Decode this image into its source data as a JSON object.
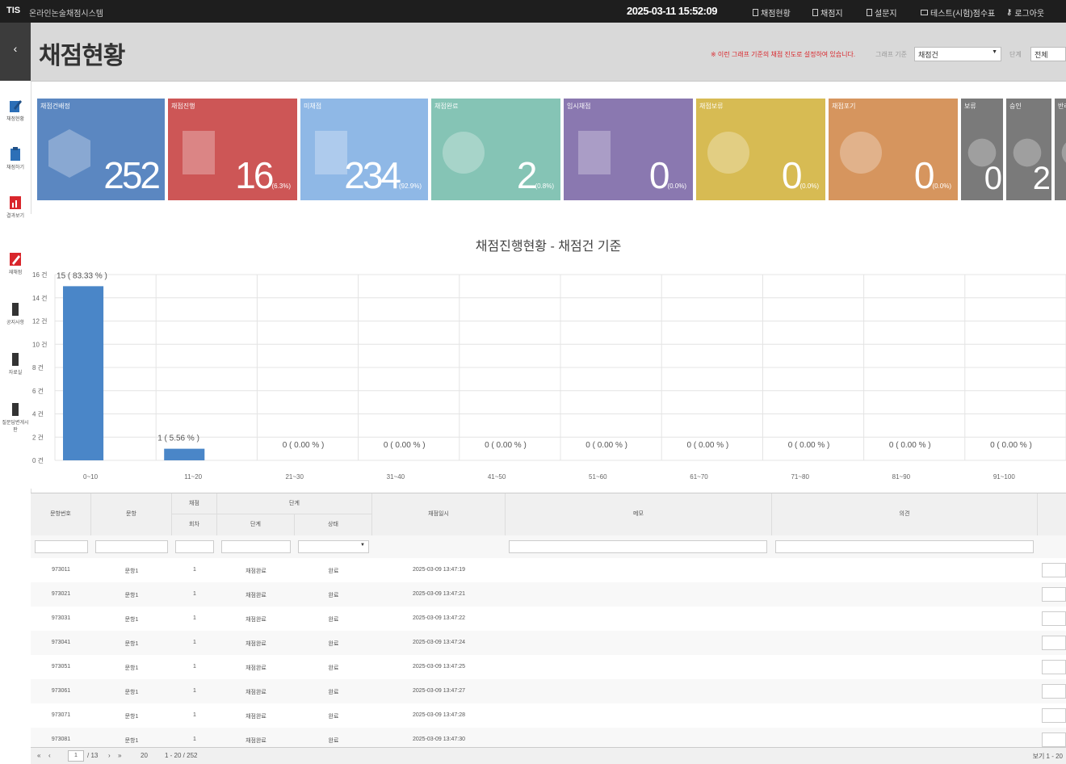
{
  "topbar": {
    "logo": "TIS",
    "app_name": "온라인논술채점시스템",
    "clock": "2025-03-11 15:52:09",
    "menu": [
      {
        "label": "채점현황",
        "icon": "doc-icon"
      },
      {
        "label": "채점지",
        "icon": "device-icon"
      },
      {
        "label": "설문지",
        "icon": "device-icon"
      },
      {
        "label": "테스트(시험)점수표",
        "icon": "mail-icon"
      },
      {
        "label": "로그아웃",
        "icon": "key-icon"
      }
    ]
  },
  "sidenav": {
    "items": [
      {
        "label": "채점현황",
        "icon": "edit-icon"
      },
      {
        "label": "채점하기",
        "icon": "doc-icon"
      },
      {
        "label": "결과보기",
        "icon": "chart-icon"
      },
      {
        "label": "재채점",
        "icon": "pen-icon"
      },
      {
        "label": "공지사항",
        "icon": "phone-icon"
      },
      {
        "label": "자료실",
        "icon": "phone-icon"
      },
      {
        "label": "질문답변게시판",
        "icon": "phone-icon"
      }
    ]
  },
  "header": {
    "title": "채점현황",
    "note": "※ 이런 그래프 기준의 채점 진도로 설정하여 있습니다.",
    "filter1_label": "그래프 기준",
    "filter1_value": "채점건",
    "filter2_label": "단계",
    "filter2_value": "전체"
  },
  "cards": [
    {
      "title": "채점건배정",
      "value": "252",
      "pct": "",
      "color": "#5b87c1",
      "icon": "box-icon"
    },
    {
      "title": "채점진행",
      "value": "16",
      "pct": "(6.3%)",
      "color": "#cd5656",
      "icon": "form-check-icon"
    },
    {
      "title": "미채점",
      "value": "234",
      "pct": "(92.9%)",
      "color": "#8fb8e6",
      "icon": "paper-icon"
    },
    {
      "title": "채점완료",
      "value": "2",
      "pct": "(0.8%)",
      "color": "#85c4b5",
      "icon": "check-circle-icon"
    },
    {
      "title": "임시채점",
      "value": "0",
      "pct": "(0.0%)",
      "color": "#8a78b0",
      "icon": "form-pen-icon"
    },
    {
      "title": "채점보류",
      "value": "0",
      "pct": "(0.0%)",
      "color": "#d7bb53",
      "icon": "alert-circle-icon"
    },
    {
      "title": "채점포기",
      "value": "0",
      "pct": "(0.0%)",
      "color": "#d6955e",
      "icon": "x-circle-icon"
    },
    {
      "title": "보류",
      "value": "0",
      "pct": "",
      "color": "#7a7a7a",
      "icon": "alert-circle-icon"
    },
    {
      "title": "승인",
      "value": "2",
      "pct": "",
      "color": "#7a7a7a",
      "icon": "check-circle-icon"
    },
    {
      "title": "반려",
      "value": "",
      "pct": "",
      "color": "#7a7a7a",
      "icon": "x-circle-icon"
    }
  ],
  "chart_data": {
    "type": "bar",
    "title": "채점진행현황 - 채점건 기준",
    "categories": [
      "0~10",
      "11~20",
      "21~30",
      "31~40",
      "41~50",
      "51~60",
      "61~70",
      "71~80",
      "81~90",
      "91~100"
    ],
    "values": [
      15,
      1,
      0,
      0,
      0,
      0,
      0,
      0,
      0,
      0
    ],
    "data_labels": [
      "15 ( 83.33 % )",
      "1 ( 5.56 % )",
      "0 ( 0.00 % )",
      "0 ( 0.00 % )",
      "0 ( 0.00 % )",
      "0 ( 0.00 % )",
      "0 ( 0.00 % )",
      "0 ( 0.00 % )",
      "0 ( 0.00 % )",
      "0 ( 0.00 % )"
    ],
    "yticks": [
      "0 건",
      "2 건",
      "4 건",
      "6 건",
      "8 건",
      "10 건",
      "12 건",
      "14 건",
      "16 건"
    ],
    "ylim": [
      0,
      16
    ],
    "bar_color": "#4a86c8",
    "grid": true
  },
  "grid": {
    "headers": [
      "문항번호",
      "문항",
      "채점",
      "단계",
      "채점일시",
      "메모",
      "의견"
    ],
    "subheaders": [
      "회차",
      "단계",
      "상태"
    ],
    "rows": [
      [
        "973011",
        "문항1",
        "1",
        "채점완료",
        "완료",
        "2025-03-09 13:47:19"
      ],
      [
        "973021",
        "문항1",
        "1",
        "채점완료",
        "완료",
        "2025-03-09 13:47:21"
      ],
      [
        "973031",
        "문항1",
        "1",
        "채점완료",
        "완료",
        "2025-03-09 13:47:22"
      ],
      [
        "973041",
        "문항1",
        "1",
        "채점완료",
        "완료",
        "2025-03-09 13:47:24"
      ],
      [
        "973051",
        "문항1",
        "1",
        "채점완료",
        "완료",
        "2025-03-09 13:47:25"
      ],
      [
        "973061",
        "문항1",
        "1",
        "채점완료",
        "완료",
        "2025-03-09 13:47:27"
      ],
      [
        "973071",
        "문항1",
        "1",
        "채점완료",
        "완료",
        "2025-03-09 13:47:28"
      ],
      [
        "973081",
        "문항1",
        "1",
        "채점완료",
        "완료",
        "2025-03-09 13:47:30"
      ]
    ]
  },
  "pager": {
    "page": "1",
    "total": "/ 13",
    "per_page": "20",
    "range": "1 - 20 / 252",
    "right": "보기 1 - 20"
  }
}
